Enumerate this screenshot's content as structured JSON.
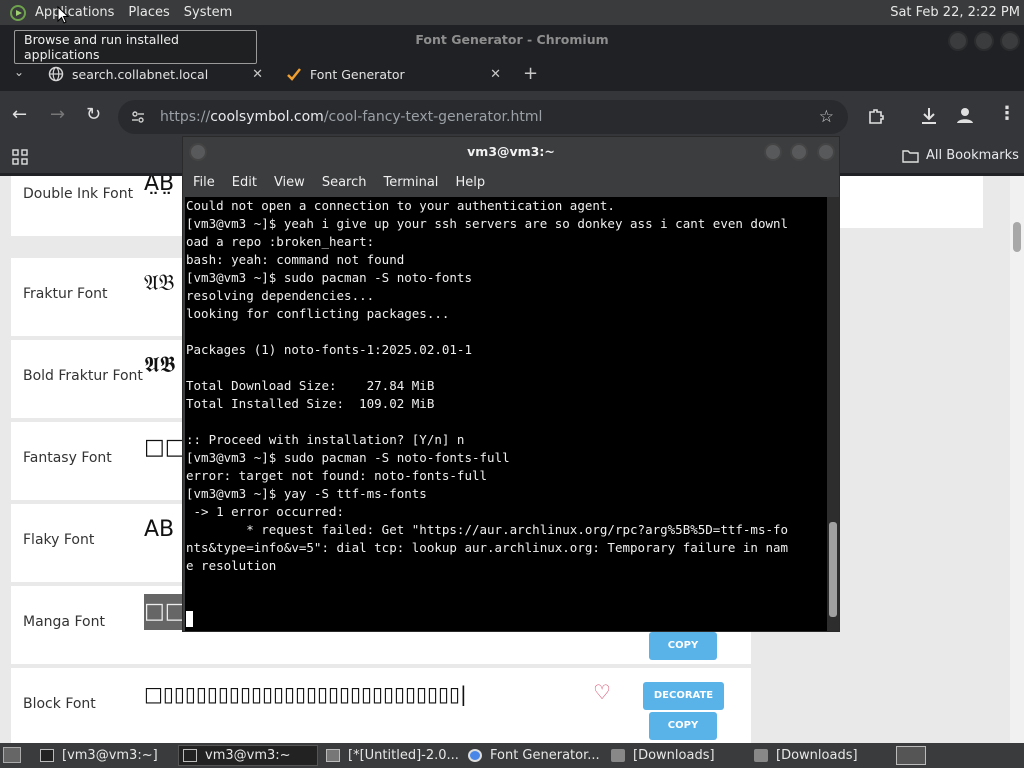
{
  "top_panel": {
    "menus": [
      "Applications",
      "Places",
      "System"
    ],
    "clock": "Sat Feb 22,  2:22 PM"
  },
  "tooltip": "Browse and run installed applications",
  "browser": {
    "window_title": "Font Generator - Chromium",
    "tabs": [
      {
        "label": "search.collabnet.local",
        "close": "✕"
      },
      {
        "label": "Font Generator",
        "close": "✕"
      }
    ],
    "new_tab": "+",
    "url_prefix": "https://",
    "url_domain": "coolsymbol.com",
    "url_path": "/cool-fancy-text-generator.html",
    "all_bookmarks": "All Bookmarks"
  },
  "fonts": [
    {
      "name": "Double Ink Font",
      "sample": "Ä̤B̤̈"
    },
    {
      "name": "Fraktur Font",
      "sample": "𝔄𝔅"
    },
    {
      "name": "Bold Fraktur Font",
      "sample": "𝕬𝕭"
    },
    {
      "name": "Fantasy Font",
      "sample": "□□"
    },
    {
      "name": "Flaky Font",
      "sample": "AB"
    },
    {
      "name": "Manga Font",
      "sample": "□□"
    },
    {
      "name": "Block Font",
      "sample": "□▯▯▯▯▯▯▯▯▯▯▯▯▯▯▯▯▯▯▯▯▯▯▯▯▯▯▯|"
    }
  ],
  "buttons": {
    "decorate": "DECORATE",
    "copy": "COPY"
  },
  "terminal": {
    "title": "vm3@vm3:~",
    "menu": [
      "File",
      "Edit",
      "View",
      "Search",
      "Terminal",
      "Help"
    ],
    "lines": [
      "Could not open a connection to your authentication agent.",
      "[vm3@vm3 ~]$ yeah i give up your ssh servers are so donkey ass i cant even downl",
      "oad a repo :broken_heart:",
      "bash: yeah: command not found",
      "[vm3@vm3 ~]$ sudo pacman -S noto-fonts",
      "resolving dependencies...",
      "looking for conflicting packages...",
      "",
      "Packages (1) noto-fonts-1:2025.02.01-1",
      "",
      "Total Download Size:    27.84 MiB",
      "Total Installed Size:  109.02 MiB",
      "",
      ":: Proceed with installation? [Y/n] n",
      "[vm3@vm3 ~]$ sudo pacman -S noto-fonts-full",
      "error: target not found: noto-fonts-full",
      "[vm3@vm3 ~]$ yay -S ttf-ms-fonts",
      " -> 1 error occurred:",
      "        * request failed: Get \"https://aur.archlinux.org/rpc?arg%5B%5D=ttf-ms-fo",
      "nts&type=info&v=5\": dial tcp: lookup aur.archlinux.org: Temporary failure in nam",
      "e resolution"
    ]
  },
  "taskbar": [
    {
      "label": "[vm3@vm3:~]",
      "active": false
    },
    {
      "label": "vm3@vm3:~",
      "active": true
    },
    {
      "label": "[*[Untitled]-2.0...",
      "active": false
    },
    {
      "label": "Font Generator...",
      "active": false
    },
    {
      "label": "[Downloads]",
      "active": false
    },
    {
      "label": "[Downloads]",
      "active": false
    }
  ]
}
